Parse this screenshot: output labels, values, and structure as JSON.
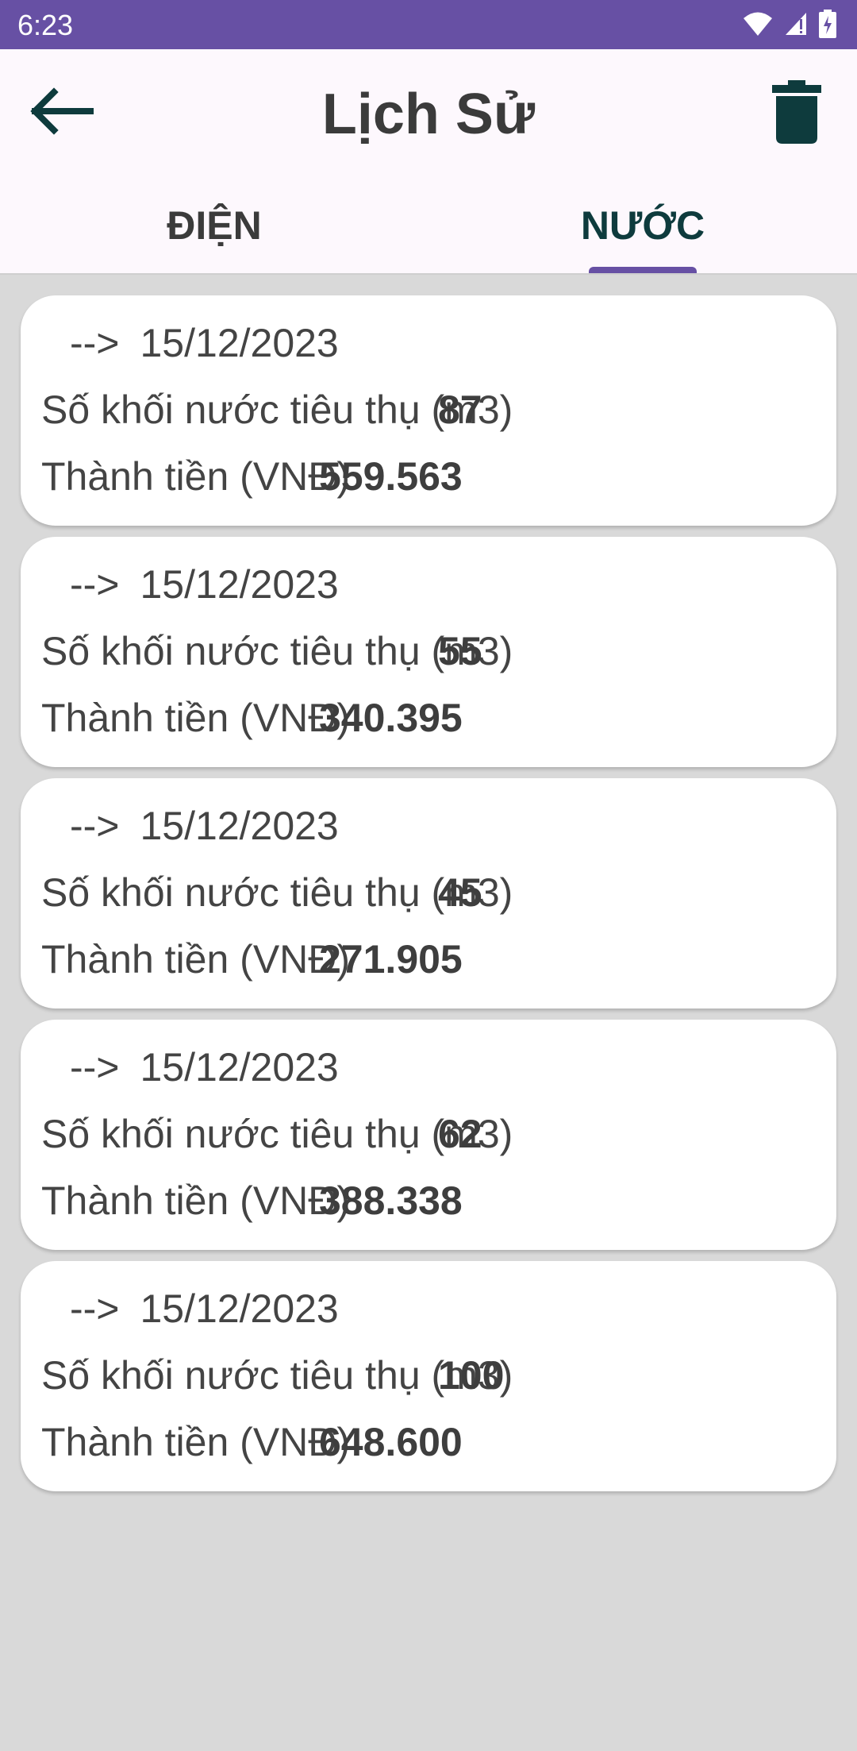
{
  "status_bar": {
    "time": "6:23",
    "icons": [
      "wifi-icon",
      "cell-signal-icon",
      "battery-charging-icon"
    ]
  },
  "app_bar": {
    "title": "Lịch Sử",
    "back_icon": "arrow-left-icon",
    "delete_icon": "trash-icon"
  },
  "tabs": [
    {
      "label": "ĐIỆN",
      "active": false
    },
    {
      "label": "NƯỚC",
      "active": true
    }
  ],
  "colors": {
    "status_bar": "#6750a4",
    "tab_indicator": "#6750a4",
    "icon": "#0e3b3d",
    "list_background": "#d9d9d9"
  },
  "records": [
    {
      "arrow": "-->",
      "date": "15/12/2023",
      "volume_label": "Số khối nước tiêu thụ (m3)",
      "volume": "87",
      "cost_label": "Thành tiền (VNĐ)",
      "cost": "559.563"
    },
    {
      "arrow": "-->",
      "date": "15/12/2023",
      "volume_label": "Số khối nước tiêu thụ (m3)",
      "volume": "55",
      "cost_label": "Thành tiền (VNĐ)",
      "cost": "340.395"
    },
    {
      "arrow": "-->",
      "date": "15/12/2023",
      "volume_label": "Số khối nước tiêu thụ (m3)",
      "volume": "45",
      "cost_label": "Thành tiền (VNĐ)",
      "cost": "271.905"
    },
    {
      "arrow": "-->",
      "date": "15/12/2023",
      "volume_label": "Số khối nước tiêu thụ (m3)",
      "volume": "62",
      "cost_label": "Thành tiền (VNĐ)",
      "cost": "388.338"
    },
    {
      "arrow": "-->",
      "date": "15/12/2023",
      "volume_label": "Số khối nước tiêu thụ (m3)",
      "volume": "100",
      "cost_label": "Thành tiền (VNĐ)",
      "cost": "648.600"
    }
  ]
}
